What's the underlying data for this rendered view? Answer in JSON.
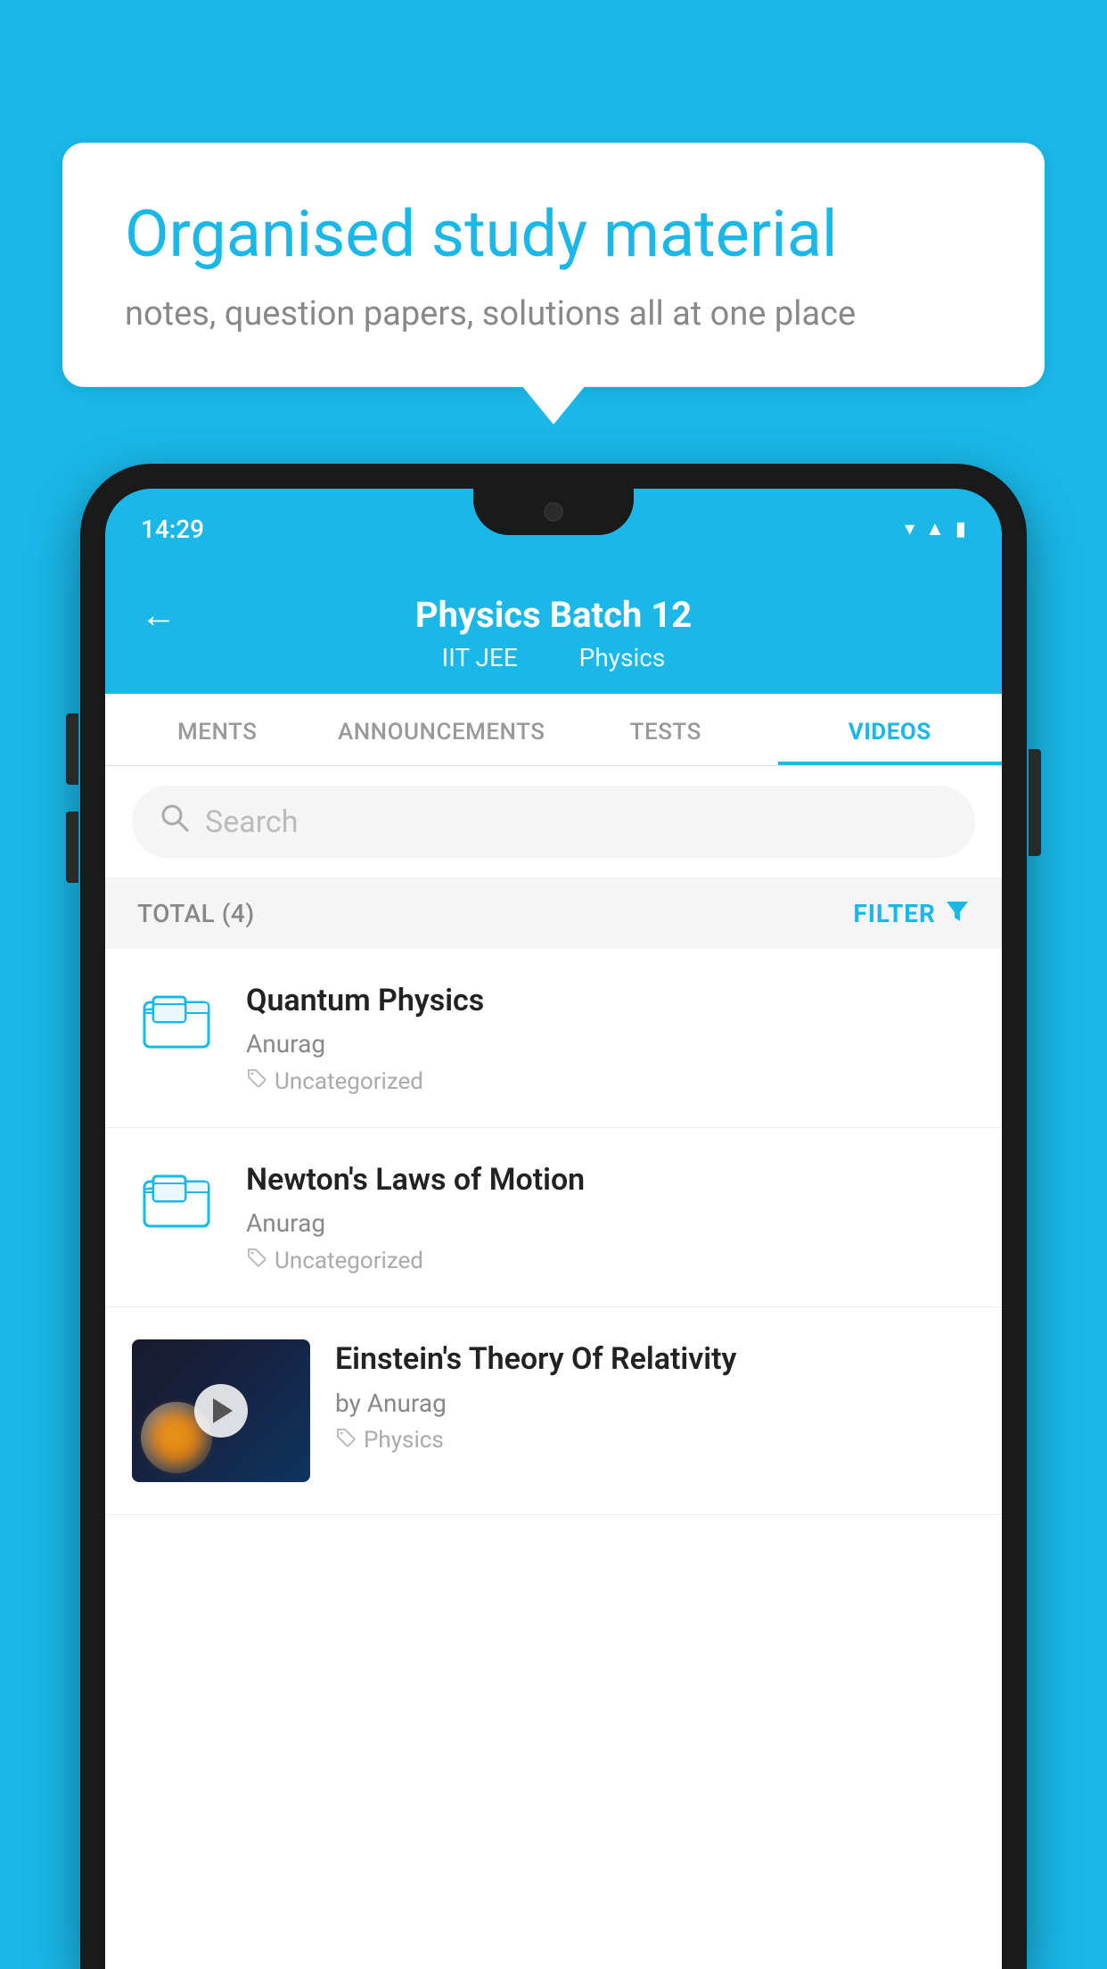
{
  "background_color": "#1ab8e8",
  "speech_bubble": {
    "heading": "Organised study material",
    "subtext": "notes, question papers, solutions all at one place"
  },
  "phone": {
    "status_bar": {
      "time": "14:29"
    },
    "header": {
      "title": "Physics Batch 12",
      "subtitle_part1": "IIT JEE",
      "subtitle_part2": "Physics",
      "back_label": "←"
    },
    "tabs": [
      {
        "label": "MENTS",
        "active": false
      },
      {
        "label": "ANNOUNCEMENTS",
        "active": false
      },
      {
        "label": "TESTS",
        "active": false
      },
      {
        "label": "VIDEOS",
        "active": true
      }
    ],
    "search": {
      "placeholder": "Search"
    },
    "filter_bar": {
      "total_label": "TOTAL (4)",
      "filter_label": "FILTER"
    },
    "videos": [
      {
        "title": "Quantum Physics",
        "author": "Anurag",
        "tag": "Uncategorized",
        "has_thumbnail": false
      },
      {
        "title": "Newton's Laws of Motion",
        "author": "Anurag",
        "tag": "Uncategorized",
        "has_thumbnail": false
      },
      {
        "title": "Einstein's Theory Of Relativity",
        "author": "by Anurag",
        "tag": "Physics",
        "has_thumbnail": true
      }
    ]
  }
}
